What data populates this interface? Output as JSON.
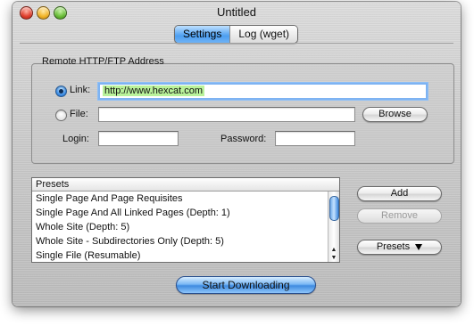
{
  "window": {
    "title": "Untitled"
  },
  "tabs": [
    {
      "label": "Settings",
      "active": true
    },
    {
      "label": "Log (wget)",
      "active": false
    }
  ],
  "remote": {
    "group_title": "Remote HTTP/FTP Address",
    "link_label": "Link:",
    "link_value": "http://www.hexcat.com",
    "file_label": "File:",
    "file_value": "",
    "browse_label": "Browse",
    "login_label": "Login:",
    "login_value": "",
    "password_label": "Password:",
    "password_value": ""
  },
  "presets": {
    "header": "Presets",
    "items": [
      "Single Page And Page Requisites",
      "Single Page And All Linked Pages (Depth: 1)",
      "Whole Site (Depth: 5)",
      "Whole Site - Subdirectories Only (Depth: 5)",
      "Single File (Resumable)"
    ],
    "add_label": "Add",
    "remove_label": "Remove",
    "presets_menu_label": "Presets"
  },
  "footer": {
    "start_label": "Start Downloading"
  },
  "colors": {
    "url_highlight": "#b9f29b",
    "accent_blue": "#4c9ef0"
  },
  "icons": {
    "close": "close-traffic-light-icon",
    "minimize": "minimize-traffic-light-icon",
    "zoom": "zoom-traffic-light-icon",
    "dropdown": "arrow-down-icon"
  }
}
